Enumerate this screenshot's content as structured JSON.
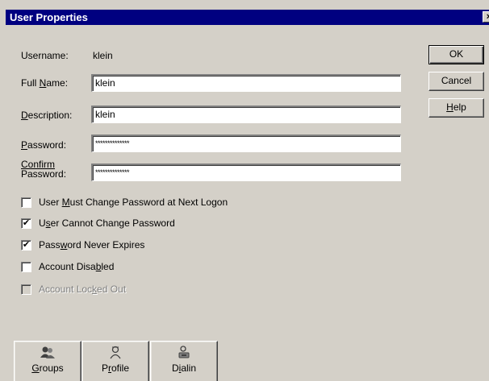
{
  "window": {
    "title": "User Properties",
    "close_glyph": "×"
  },
  "username": {
    "label": "Username:",
    "value": "klein"
  },
  "full_name": {
    "label_pre": "Full ",
    "label_u": "N",
    "label_post": "ame:",
    "value": "klein"
  },
  "description": {
    "label_u": "D",
    "label_post": "escription:",
    "value": "klein"
  },
  "password": {
    "label_u": "P",
    "label_post": "assword:",
    "value": "**************"
  },
  "confirm_password": {
    "label_line1": "Confirm",
    "label_line2": "Password:",
    "value": "**************"
  },
  "checkboxes": [
    {
      "pre": "User ",
      "u": "M",
      "post": "ust Change Password at Next Logon",
      "checked": false,
      "enabled": true
    },
    {
      "pre": "U",
      "u": "s",
      "post": "er Cannot Change Password",
      "checked": true,
      "enabled": true
    },
    {
      "pre": "Pass",
      "u": "w",
      "post": "ord Never Expires",
      "checked": true,
      "enabled": true
    },
    {
      "pre": "Account Disa",
      "u": "b",
      "post": "led",
      "checked": false,
      "enabled": true
    },
    {
      "pre": "Account Loc",
      "u": "k",
      "post": "ed Out",
      "checked": false,
      "enabled": false
    }
  ],
  "check_glyph": "✔",
  "buttons": {
    "ok": "OK",
    "cancel": "Cancel",
    "help_u": "H",
    "help_post": "elp"
  },
  "bottom_buttons": {
    "groups_u": "G",
    "groups_post": "roups",
    "groups_icon": "groups-icon",
    "profile_pre": "P",
    "profile_u": "r",
    "profile_post": "ofile",
    "profile_icon": "profile-icon",
    "dialin_pre": "D",
    "dialin_u": "i",
    "dialin_post": "alin",
    "dialin_icon": "phone-dialin-icon"
  }
}
